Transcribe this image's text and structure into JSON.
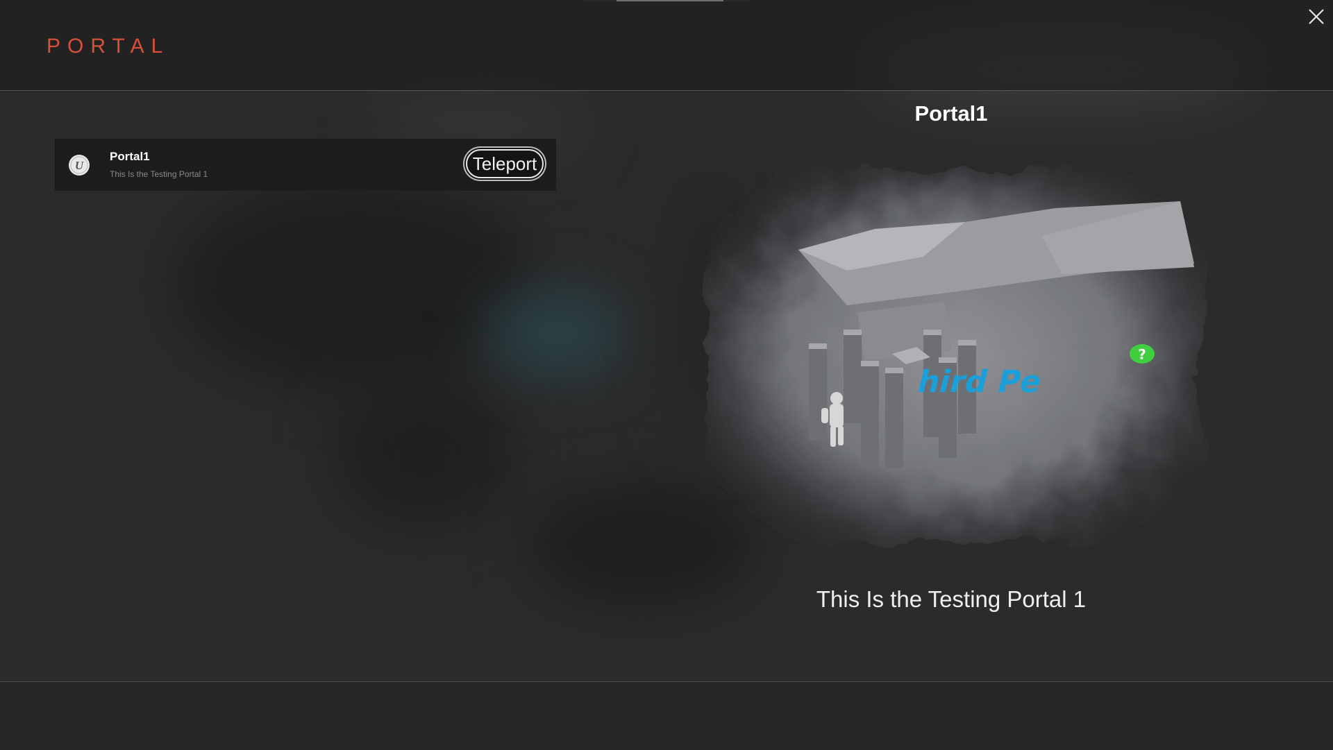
{
  "header": {
    "title": "PORTAL",
    "close_icon": "close-icon"
  },
  "loading_progress": 0.8,
  "portal_list": [
    {
      "name": "Portal1",
      "description": "This Is the Testing Portal 1",
      "icon": "unreal-logo-icon",
      "button_label": "Teleport"
    }
  ],
  "detail": {
    "title": "Portal1",
    "description": "This Is the Testing Portal 1",
    "preview_overlay_text": "hird Pe"
  },
  "colors": {
    "accent": "#d9503a",
    "background": "#2b2b2b",
    "list_item_bg": "#1d1d1d",
    "preview_text": "#1a9fd8",
    "marker_green": "#3fcf3f"
  }
}
